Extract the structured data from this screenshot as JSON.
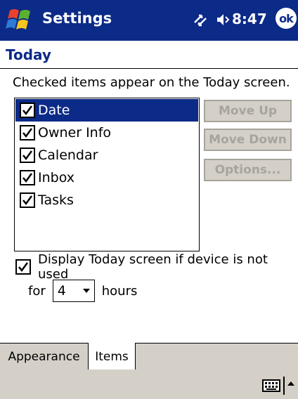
{
  "titlebar": {
    "app_title": "Settings",
    "clock": "8:47",
    "ok_label": "ok",
    "icons": [
      "windows-start-icon",
      "connectivity-icon",
      "speaker-icon"
    ]
  },
  "page": {
    "title": "Today",
    "instructions": "Checked items appear on the Today screen."
  },
  "list": {
    "items": [
      {
        "label": "Date",
        "checked": true,
        "selected": true
      },
      {
        "label": "Owner Info",
        "checked": true,
        "selected": false
      },
      {
        "label": "Calendar",
        "checked": true,
        "selected": false
      },
      {
        "label": "Inbox",
        "checked": true,
        "selected": false
      },
      {
        "label": "Tasks",
        "checked": true,
        "selected": false
      }
    ]
  },
  "buttons": {
    "move_up": "Move Up",
    "move_down": "Move Down",
    "options": "Options..."
  },
  "timeout": {
    "display_label": "Display Today screen if device is not used",
    "checked": true,
    "for_label": "for",
    "hours_value": "4",
    "hours_label": "hours"
  },
  "tabs": [
    {
      "label": "Appearance",
      "active": false
    },
    {
      "label": "Items",
      "active": true
    }
  ],
  "menubar": {
    "icons": [
      "keyboard-icon",
      "sip-arrow-icon"
    ]
  },
  "colors": {
    "titlebar_bg": "#0c2a87",
    "selection_bg": "#0c2a87",
    "page_title": "#0c2a87",
    "chrome_gray": "#d4d0c8",
    "disabled_text": "#a7a49c"
  }
}
